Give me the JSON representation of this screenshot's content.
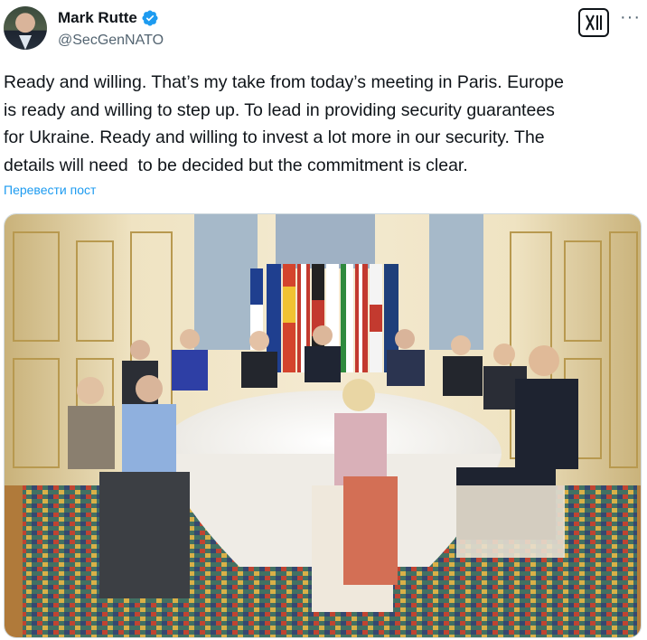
{
  "author": {
    "display_name": "Mark Rutte",
    "handle": "@SecGenNATO",
    "verified_icon": "verified-badge-icon",
    "avatar_icon": "profile-avatar"
  },
  "actions": {
    "grok_icon": "grok-icon",
    "more_icon": "more-options-icon",
    "more_label": "···"
  },
  "post": {
    "text": "Ready and willing. That’s my take from today’s meeting in Paris. Europe\nis ready and willing to step up. To lead in providing security guarantees\nfor Ukraine. Ready and willing to invest a lot more in our security. The\ndetails will need  to be decided but the commitment is clear.",
    "translate_label": "Перевести пост"
  },
  "media": {
    "type": "photo",
    "icon": "meeting-photo"
  },
  "colors": {
    "link": "#1d9bf0",
    "verified": "#1d9bf0",
    "secondary_text": "#536471"
  }
}
